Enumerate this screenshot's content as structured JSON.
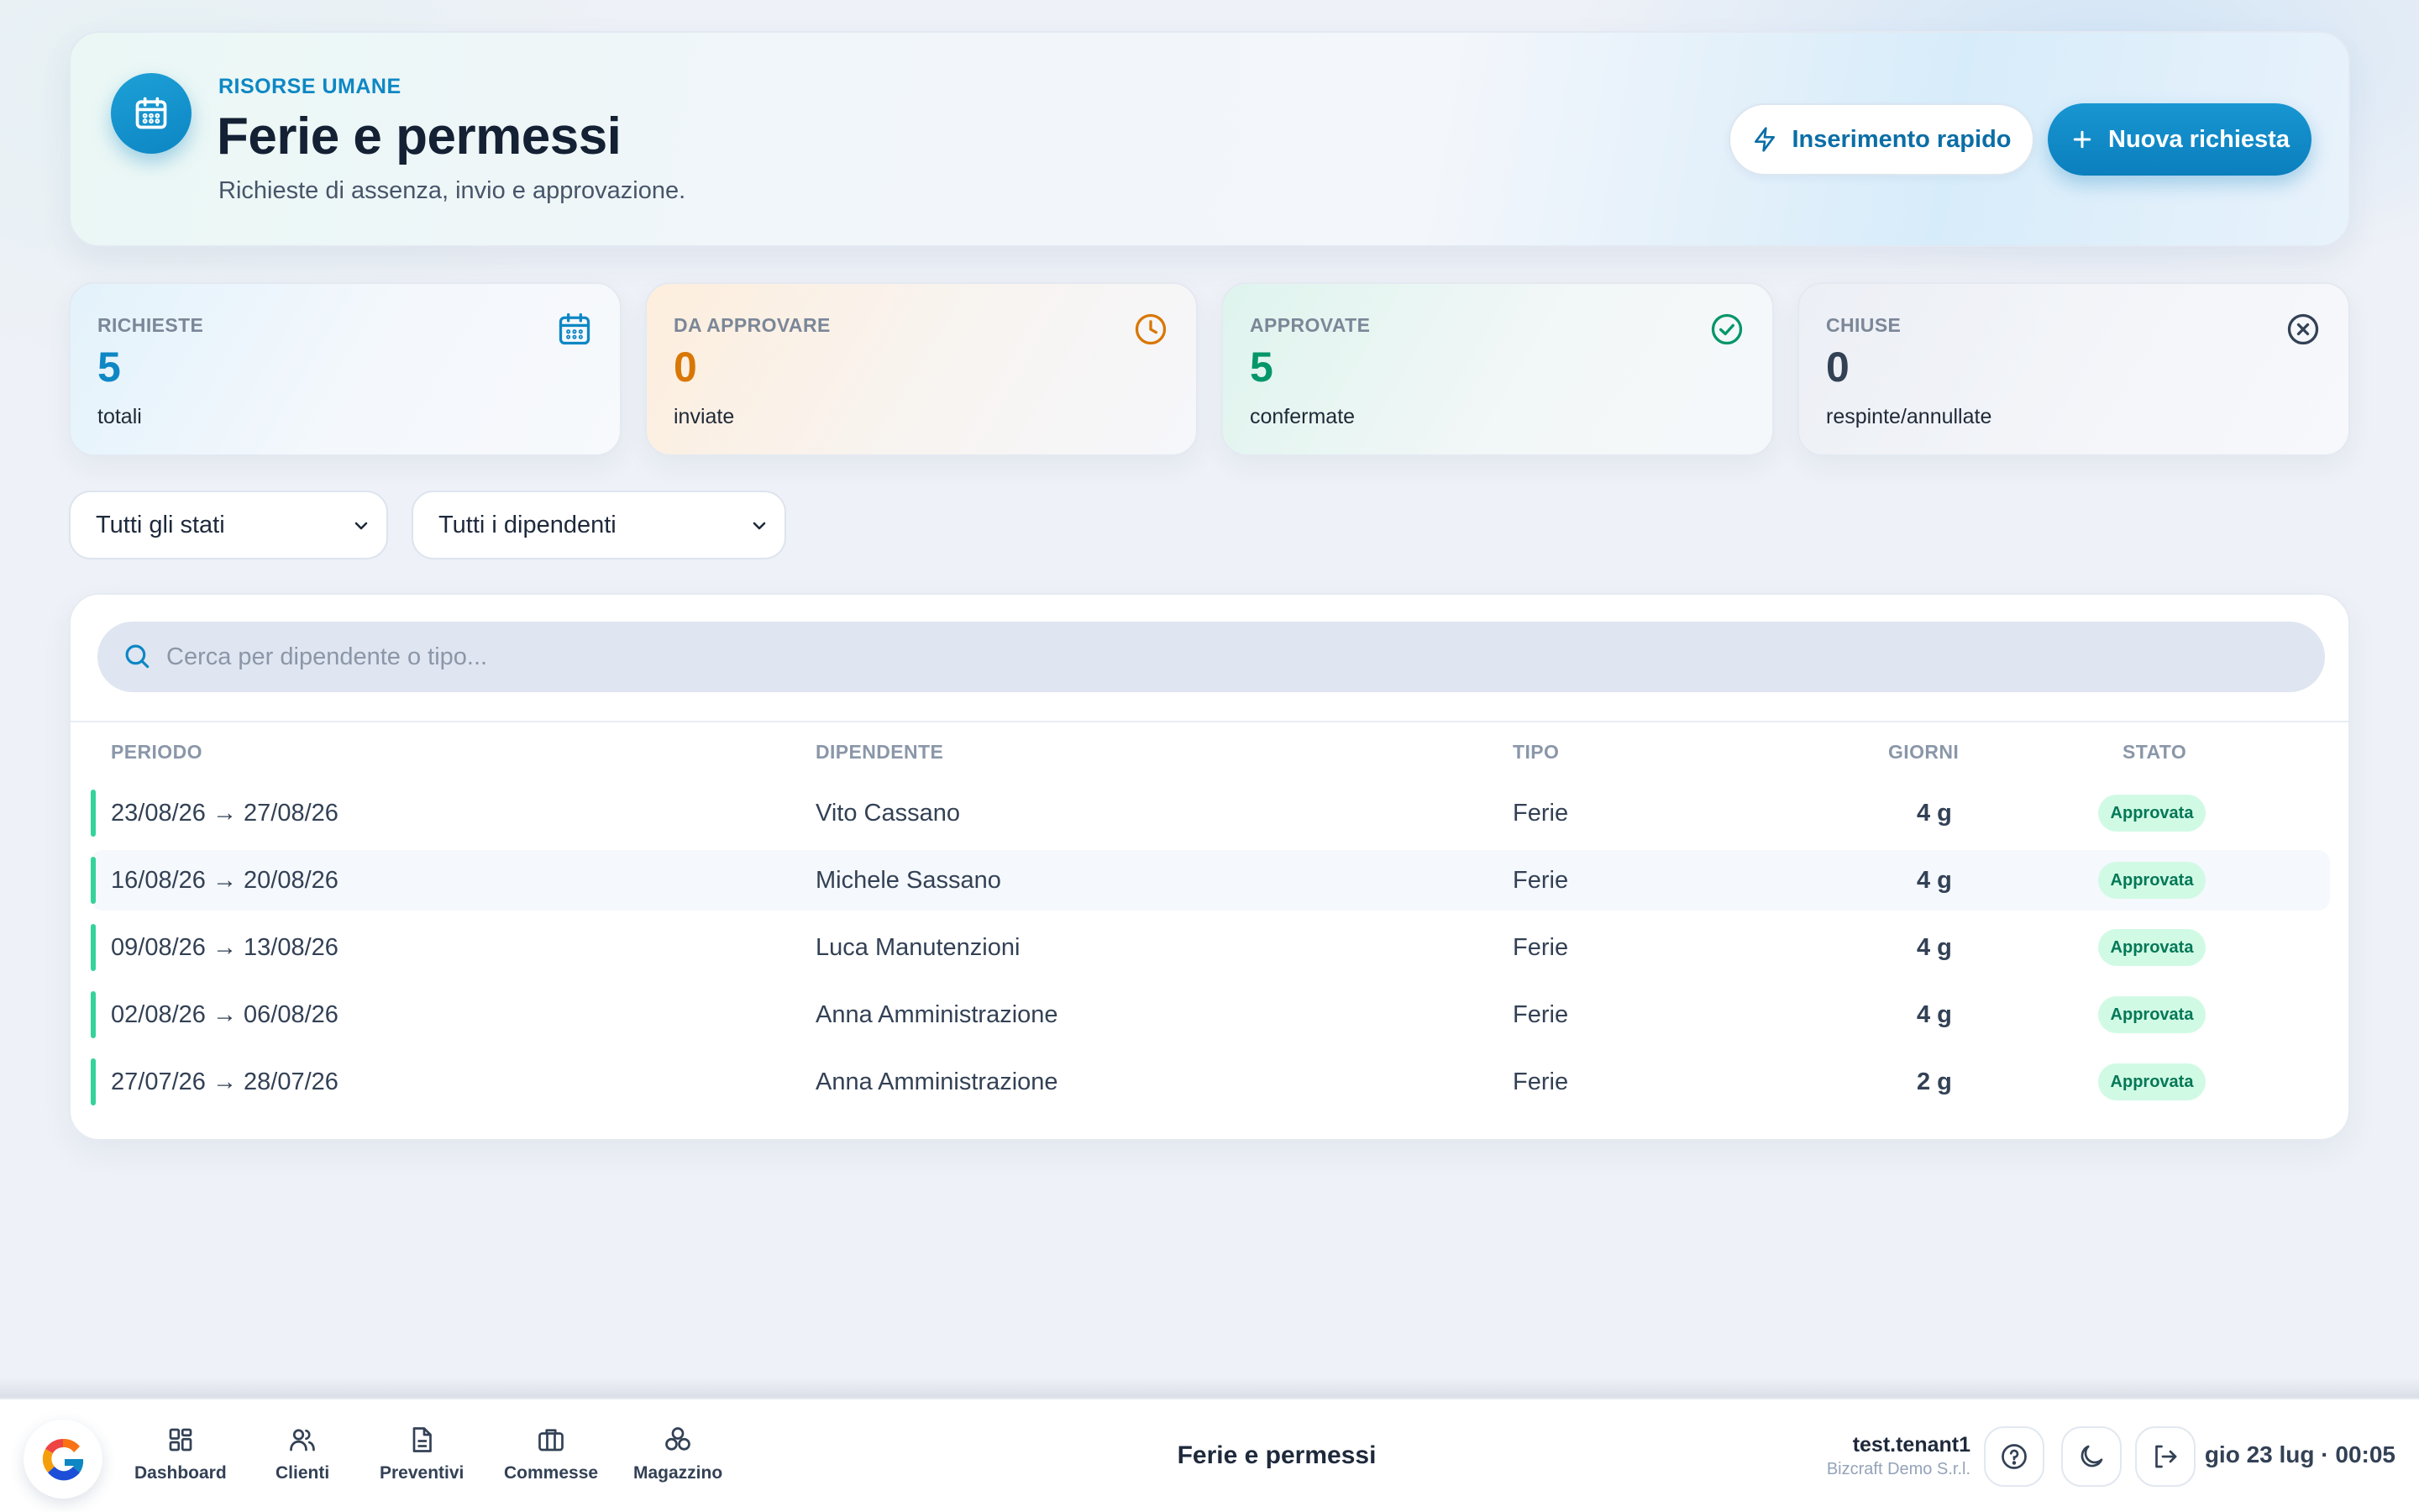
{
  "header": {
    "eyebrow": "RISORSE UMANE",
    "title": "Ferie e permessi",
    "subtitle": "Richieste di assenza, invio e approvazione.",
    "quick_button": "Inserimento rapido",
    "new_button": "Nuova richiesta",
    "icon": "calendar-icon"
  },
  "stats": [
    {
      "label": "RICHIESTE",
      "value": "5",
      "sub": "totali",
      "icon": "calendar-icon",
      "color": "#0e87c4"
    },
    {
      "label": "DA APPROVARE",
      "value": "0",
      "sub": "inviate",
      "icon": "clock-icon",
      "color": "#d97706"
    },
    {
      "label": "APPROVATE",
      "value": "5",
      "sub": "confermate",
      "icon": "check-circle-icon",
      "color": "#059669"
    },
    {
      "label": "CHIUSE",
      "value": "0",
      "sub": "respinte/annullate",
      "icon": "x-circle-icon",
      "color": "#334155"
    }
  ],
  "filters": {
    "status": "Tutti gli stati",
    "employee": "Tutti i dipendenti"
  },
  "search": {
    "placeholder": "Cerca per dipendente o tipo..."
  },
  "table": {
    "columns": [
      "PERIODO",
      "DIPENDENTE",
      "TIPO",
      "GIORNI",
      "STATO"
    ],
    "rows": [
      {
        "period": "23/08/26 → 27/08/26",
        "employee": "Vito Cassano",
        "type": "Ferie",
        "days": "4 g",
        "status": "Approvata"
      },
      {
        "period": "16/08/26 → 20/08/26",
        "employee": "Michele Sassano",
        "type": "Ferie",
        "days": "4 g",
        "status": "Approvata"
      },
      {
        "period": "09/08/26 → 13/08/26",
        "employee": "Luca Manutenzioni",
        "type": "Ferie",
        "days": "4 g",
        "status": "Approvata"
      },
      {
        "period": "02/08/26 → 06/08/26",
        "employee": "Anna Amministrazione",
        "type": "Ferie",
        "days": "4 g",
        "status": "Approvata"
      },
      {
        "period": "27/07/26 → 28/07/26",
        "employee": "Anna Amministrazione",
        "type": "Ferie",
        "days": "2 g",
        "status": "Approvata"
      }
    ]
  },
  "bottom_bar": {
    "nav": [
      {
        "label": "Dashboard",
        "icon": "grid-icon"
      },
      {
        "label": "Clienti",
        "icon": "users-icon"
      },
      {
        "label": "Preventivi",
        "icon": "document-icon"
      },
      {
        "label": "Commesse",
        "icon": "briefcase-icon"
      },
      {
        "label": "Magazzino",
        "icon": "boxes-icon"
      }
    ],
    "page_title": "Ferie e permessi",
    "user": "test.tenant1",
    "org": "Bizcraft Demo S.r.l.",
    "datetime": "gio 23 lug · 00:05"
  }
}
